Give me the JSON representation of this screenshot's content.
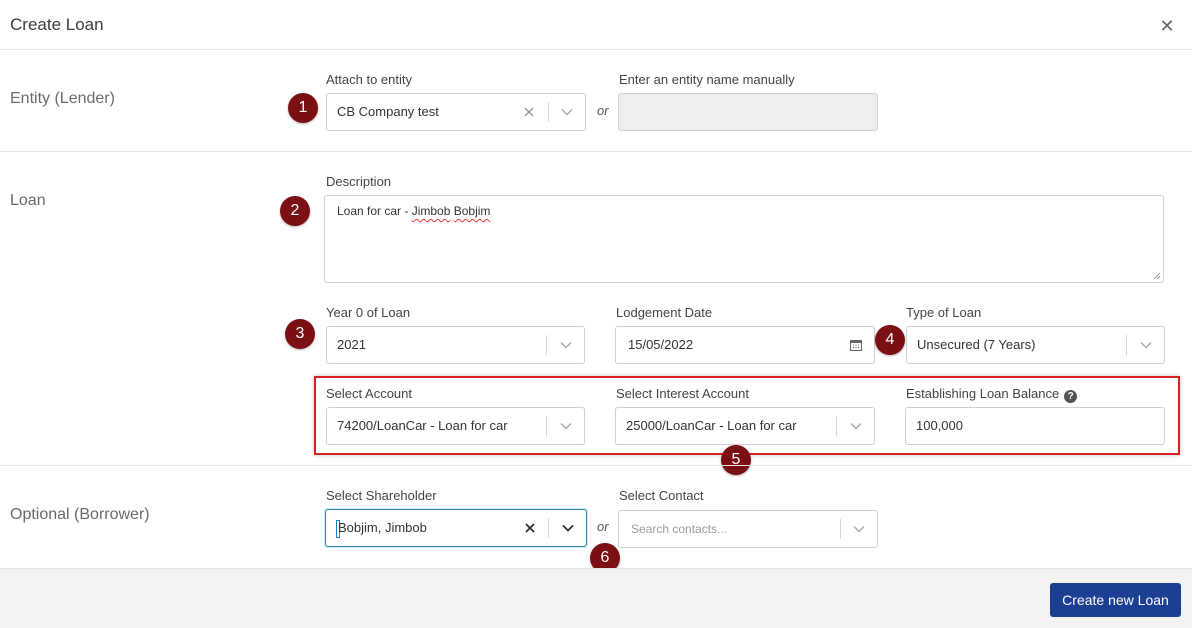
{
  "modal": {
    "title": "Create Loan",
    "close_symbol": "✕"
  },
  "sections": {
    "entity": "Entity (Lender)",
    "loan": "Loan",
    "optional": "Optional (Borrower)"
  },
  "entity": {
    "attach_label": "Attach to entity",
    "attach_value": "CB Company test",
    "or_text": "or",
    "manual_label": "Enter an entity name manually",
    "manual_value": ""
  },
  "loan": {
    "description_label": "Description",
    "description_prefix": "Loan for car - ",
    "description_name1": "Jimbob",
    "description_name2": "Bobjim",
    "year_label": "Year 0 of Loan",
    "year_value": "2021",
    "lodgement_label": "Lodgement Date",
    "lodgement_value": "15/05/2022",
    "type_label": "Type of Loan",
    "type_value": "Unsecured (7 Years)",
    "account_label": "Select Account",
    "account_value": "74200/LoanCar - Loan for car",
    "interest_label": "Select Interest Account",
    "interest_value": "25000/LoanCar - Loan for car",
    "balance_label": "Establishing Loan Balance",
    "balance_help": "?",
    "balance_value": "100,000"
  },
  "borrower": {
    "shareholder_label": "Select Shareholder",
    "shareholder_value": "Bobjim, Jimbob",
    "or_text": "or",
    "contact_label": "Select Contact",
    "contact_placeholder": "Search contacts..."
  },
  "badges": [
    "1",
    "2",
    "3",
    "4",
    "5",
    "6"
  ],
  "footer": {
    "create_label": "Create new Loan"
  },
  "icons": {
    "close": "close-icon",
    "clear": "clear-icon",
    "chevron": "chevron-down-icon",
    "calendar": "calendar-icon",
    "help": "help-icon"
  },
  "colors": {
    "badge": "#7a0f14",
    "primary": "#1c3f94",
    "highlight": "#d32222",
    "focus": "#2d7fb8"
  }
}
